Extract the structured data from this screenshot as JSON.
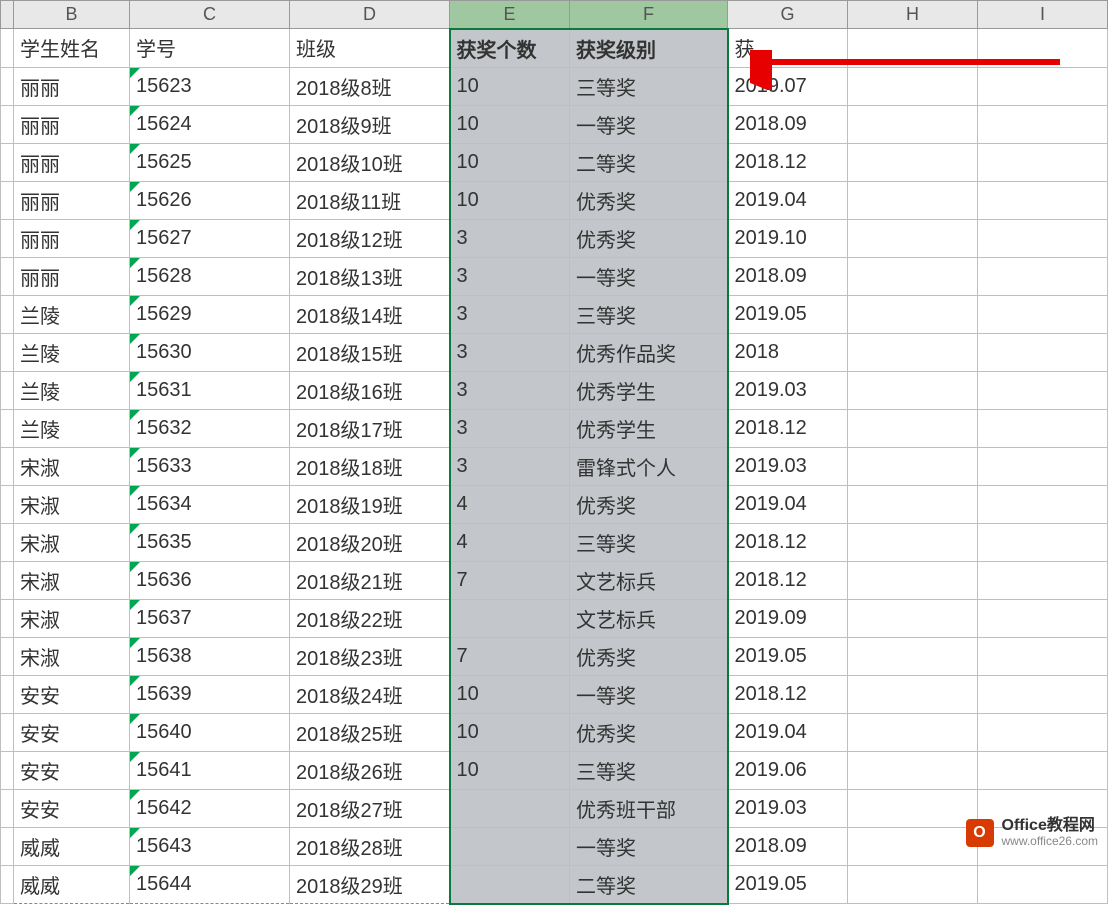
{
  "columns": [
    "",
    "B",
    "C",
    "D",
    "E",
    "F",
    "G",
    "H",
    "I"
  ],
  "headerRow": {
    "B": "学生姓名",
    "C": "学号",
    "D": "班级",
    "E": "获奖个数",
    "F": "获奖级别",
    "G": "获"
  },
  "rows": [
    {
      "B": "丽丽",
      "C": "15623",
      "D": "2018级8班",
      "E": "10",
      "F": "三等奖",
      "G": "2019.07"
    },
    {
      "B": "丽丽",
      "C": "15624",
      "D": "2018级9班",
      "E": "10",
      "F": "一等奖",
      "G": "2018.09"
    },
    {
      "B": "丽丽",
      "C": "15625",
      "D": "2018级10班",
      "E": "10",
      "F": "二等奖",
      "G": "2018.12"
    },
    {
      "B": "丽丽",
      "C": "15626",
      "D": "2018级11班",
      "E": "10",
      "F": "优秀奖",
      "G": "2019.04"
    },
    {
      "B": "丽丽",
      "C": "15627",
      "D": "2018级12班",
      "E": "3",
      "F": "优秀奖",
      "G": "2019.10"
    },
    {
      "B": "丽丽",
      "C": "15628",
      "D": "2018级13班",
      "E": "3",
      "F": "一等奖",
      "G": "2018.09"
    },
    {
      "B": "兰陵",
      "C": "15629",
      "D": "2018级14班",
      "E": "3",
      "F": "三等奖",
      "G": "2019.05"
    },
    {
      "B": "兰陵",
      "C": "15630",
      "D": "2018级15班",
      "E": "3",
      "F": "优秀作品奖",
      "G": "2018"
    },
    {
      "B": "兰陵",
      "C": "15631",
      "D": "2018级16班",
      "E": "3",
      "F": "优秀学生",
      "G": "2019.03"
    },
    {
      "B": "兰陵",
      "C": "15632",
      "D": "2018级17班",
      "E": "3",
      "F": "优秀学生",
      "G": "2018.12"
    },
    {
      "B": "宋淑",
      "C": "15633",
      "D": "2018级18班",
      "E": "3",
      "F": "雷锋式个人",
      "G": "2019.03"
    },
    {
      "B": "宋淑",
      "C": "15634",
      "D": "2018级19班",
      "E": "4",
      "F": "优秀奖",
      "G": "2019.04"
    },
    {
      "B": "宋淑",
      "C": "15635",
      "D": "2018级20班",
      "E": "4",
      "F": "三等奖",
      "G": "2018.12"
    },
    {
      "B": "宋淑",
      "C": "15636",
      "D": "2018级21班",
      "E": "7",
      "F": "文艺标兵",
      "G": "2018.12"
    },
    {
      "B": "宋淑",
      "C": "15637",
      "D": "2018级22班",
      "E": "",
      "F": "文艺标兵",
      "G": "2019.09"
    },
    {
      "B": "宋淑",
      "C": "15638",
      "D": "2018级23班",
      "E": "7",
      "F": "优秀奖",
      "G": "2019.05"
    },
    {
      "B": "安安",
      "C": "15639",
      "D": "2018级24班",
      "E": "10",
      "F": "一等奖",
      "G": "2018.12"
    },
    {
      "B": "安安",
      "C": "15640",
      "D": "2018级25班",
      "E": "10",
      "F": "优秀奖",
      "G": "2019.04"
    },
    {
      "B": "安安",
      "C": "15641",
      "D": "2018级26班",
      "E": "10",
      "F": "三等奖",
      "G": "2019.06"
    },
    {
      "B": "安安",
      "C": "15642",
      "D": "2018级27班",
      "E": "",
      "F": "优秀班干部",
      "G": "2019.03"
    },
    {
      "B": "威威",
      "C": "15643",
      "D": "2018级28班",
      "E": "",
      "F": "一等奖",
      "G": "2018.09"
    },
    {
      "B": "威威",
      "C": "15644",
      "D": "2018级29班",
      "E": "",
      "F": "二等奖",
      "G": "2019.05"
    }
  ],
  "selectedColumns": [
    "E",
    "F"
  ],
  "watermark": {
    "title": "Office教程网",
    "url": "www.office26.com",
    "logo": "O"
  }
}
